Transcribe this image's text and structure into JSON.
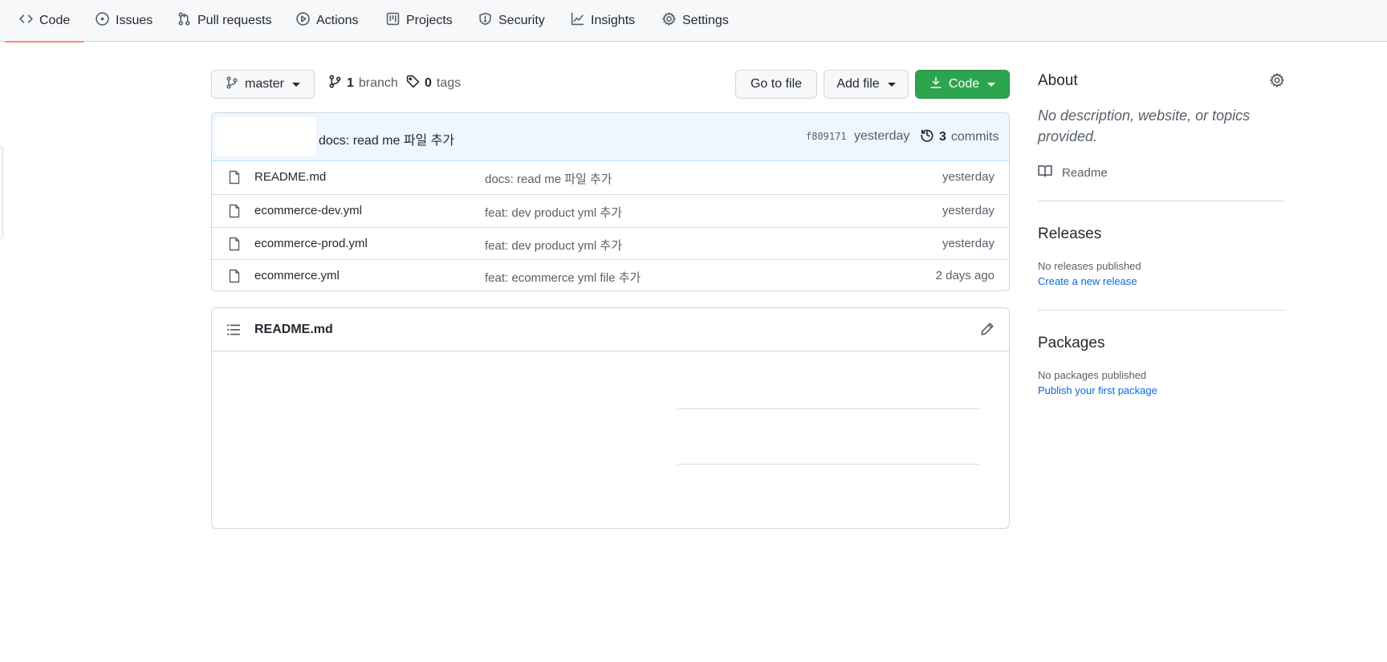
{
  "nav": {
    "tabs": [
      {
        "label": "Code",
        "icon": "code-icon",
        "selected": true
      },
      {
        "label": "Issues",
        "icon": "issue-icon"
      },
      {
        "label": "Pull requests",
        "icon": "pull-request-icon"
      },
      {
        "label": "Actions",
        "icon": "play-icon"
      },
      {
        "label": "Projects",
        "icon": "project-icon"
      },
      {
        "label": "Security",
        "icon": "shield-icon"
      },
      {
        "label": "Insights",
        "icon": "graph-icon"
      },
      {
        "label": "Settings",
        "icon": "gear-icon"
      }
    ]
  },
  "toolbar": {
    "branch_label": "master",
    "branch_count": "1",
    "branch_word": "branch",
    "tag_count": "0",
    "tag_word": "tags",
    "go_to_file": "Go to file",
    "add_file": "Add file",
    "code": "Code"
  },
  "commit": {
    "message": "docs: read me 파일 추가",
    "sha": "f809171",
    "time": "yesterday",
    "count": "3",
    "count_word": "commits"
  },
  "files": [
    {
      "name": "README.md",
      "message": "docs: read me 파일 추가",
      "time": "yesterday"
    },
    {
      "name": "ecommerce-dev.yml",
      "message": "feat: dev product yml 추가",
      "time": "yesterday"
    },
    {
      "name": "ecommerce-prod.yml",
      "message": "feat: dev product yml 추가",
      "time": "yesterday"
    },
    {
      "name": "ecommerce.yml",
      "message": "feat: ecommerce yml file 추가",
      "time": "2 days ago"
    }
  ],
  "readme": {
    "title": "README.md"
  },
  "sidebar": {
    "about_title": "About",
    "about_desc": "No description, website, or topics provided.",
    "readme_link": "Readme",
    "releases_title": "Releases",
    "releases_empty": "No releases published",
    "releases_link": "Create a new release",
    "packages_title": "Packages",
    "packages_empty": "No packages published",
    "packages_link": "Publish your first package"
  },
  "colors": {
    "accent_green": "#2da44e",
    "link_blue": "#0969da",
    "selected_tab_underline": "#fd8c73",
    "commit_header_bg": "#eef6ff"
  }
}
